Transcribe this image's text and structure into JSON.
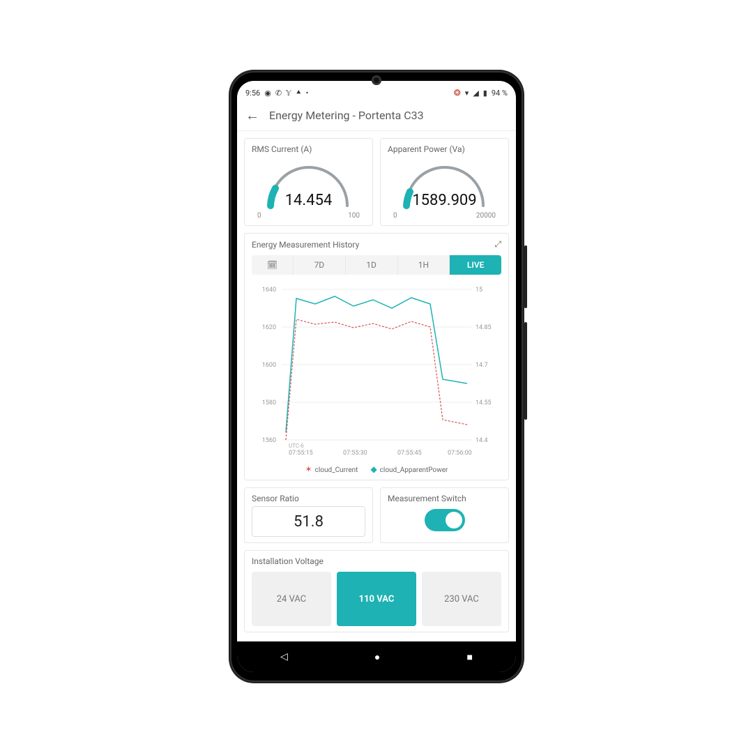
{
  "statusbar": {
    "time": "9:56",
    "battery": "94 %"
  },
  "title": "Energy Metering - Portenta C33",
  "gauges": {
    "current": {
      "title": "RMS Current (A)",
      "value": "14.454",
      "min": "0",
      "max": "100"
    },
    "power": {
      "title": "Apparent Power (Va)",
      "value": "1589.909",
      "min": "0",
      "max": "20000"
    }
  },
  "history": {
    "title": "Energy Measurement History",
    "ranges": {
      "r7d": "7D",
      "r1d": "1D",
      "r1h": "1H",
      "live": "LIVE"
    },
    "y_left": [
      "1640",
      "1620",
      "1600",
      "1580",
      "1560"
    ],
    "y_right": [
      "15",
      "14.85",
      "14.7",
      "14.55",
      "14.4"
    ],
    "x_ticks": [
      "07:55:15",
      "07:55:30",
      "07:55:45",
      "07:56:00"
    ],
    "tz": "UTC-6",
    "legend": {
      "a": "cloud_Current",
      "b": "cloud_ApparentPower"
    }
  },
  "sensor_ratio": {
    "title": "Sensor Ratio",
    "value": "51.8"
  },
  "switch": {
    "title": "Measurement Switch",
    "on": true
  },
  "voltage": {
    "title": "Installation Voltage",
    "options": {
      "v24": "24 VAC",
      "v110": "110 VAC",
      "v230": "230 VAC"
    },
    "selected": "v110"
  },
  "chart_data": {
    "type": "line",
    "x": [
      "07:55:15",
      "07:55:20",
      "07:55:25",
      "07:55:30",
      "07:55:35",
      "07:55:40",
      "07:55:45",
      "07:55:50",
      "07:55:55",
      "07:56:00",
      "07:56:05"
    ],
    "series": [
      {
        "name": "cloud_ApparentPower",
        "axis": "left",
        "values": [
          1564,
          1635,
          1632,
          1636,
          1631,
          1634,
          1630,
          1635,
          1632,
          1592,
          1590
        ]
      },
      {
        "name": "cloud_Current",
        "axis": "right",
        "values": [
          14.4,
          14.88,
          14.86,
          14.87,
          14.85,
          14.86,
          14.84,
          14.87,
          14.85,
          14.48,
          14.46
        ]
      }
    ],
    "title": "Energy Measurement History",
    "y_left_range": [
      1560,
      1640
    ],
    "y_right_range": [
      14.4,
      15.0
    ],
    "xlabel": "",
    "legend_pos": "bottom"
  }
}
